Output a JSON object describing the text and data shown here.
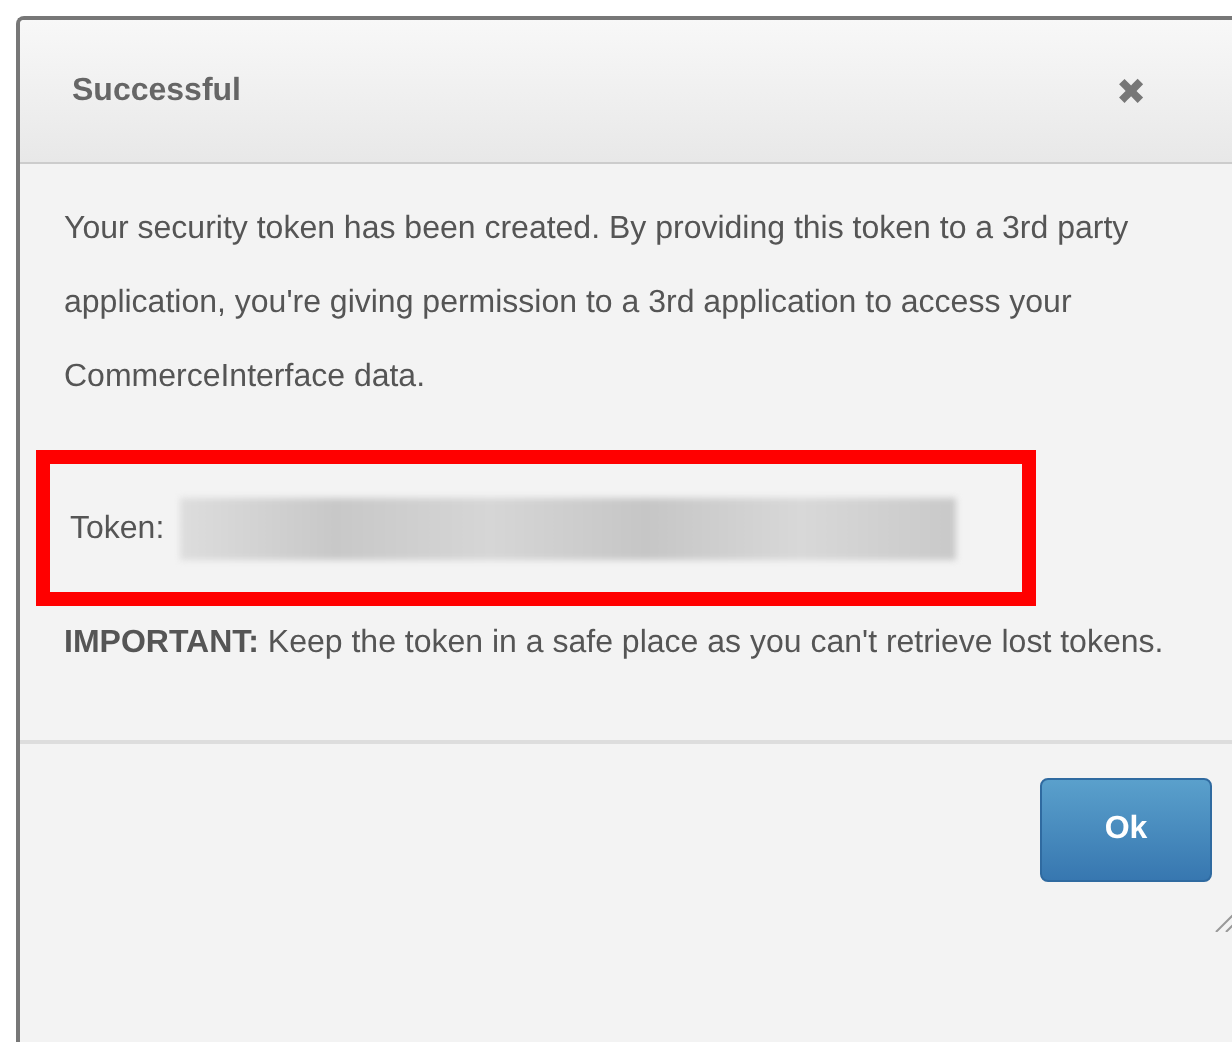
{
  "dialog": {
    "title": "Successful",
    "close": "✖",
    "message": "Your security token has been created. By providing this token to a 3rd party application, you're giving permission to a 3rd application to access your CommerceInterface data.",
    "token": {
      "label": "Token:",
      "redacted": true,
      "highlighted": true
    },
    "note": "**IMPORTANT:** Keep the token in a safe place as you can't retrieve lost tokens.",
    "buttons": [
      "Ok"
    ]
  }
}
